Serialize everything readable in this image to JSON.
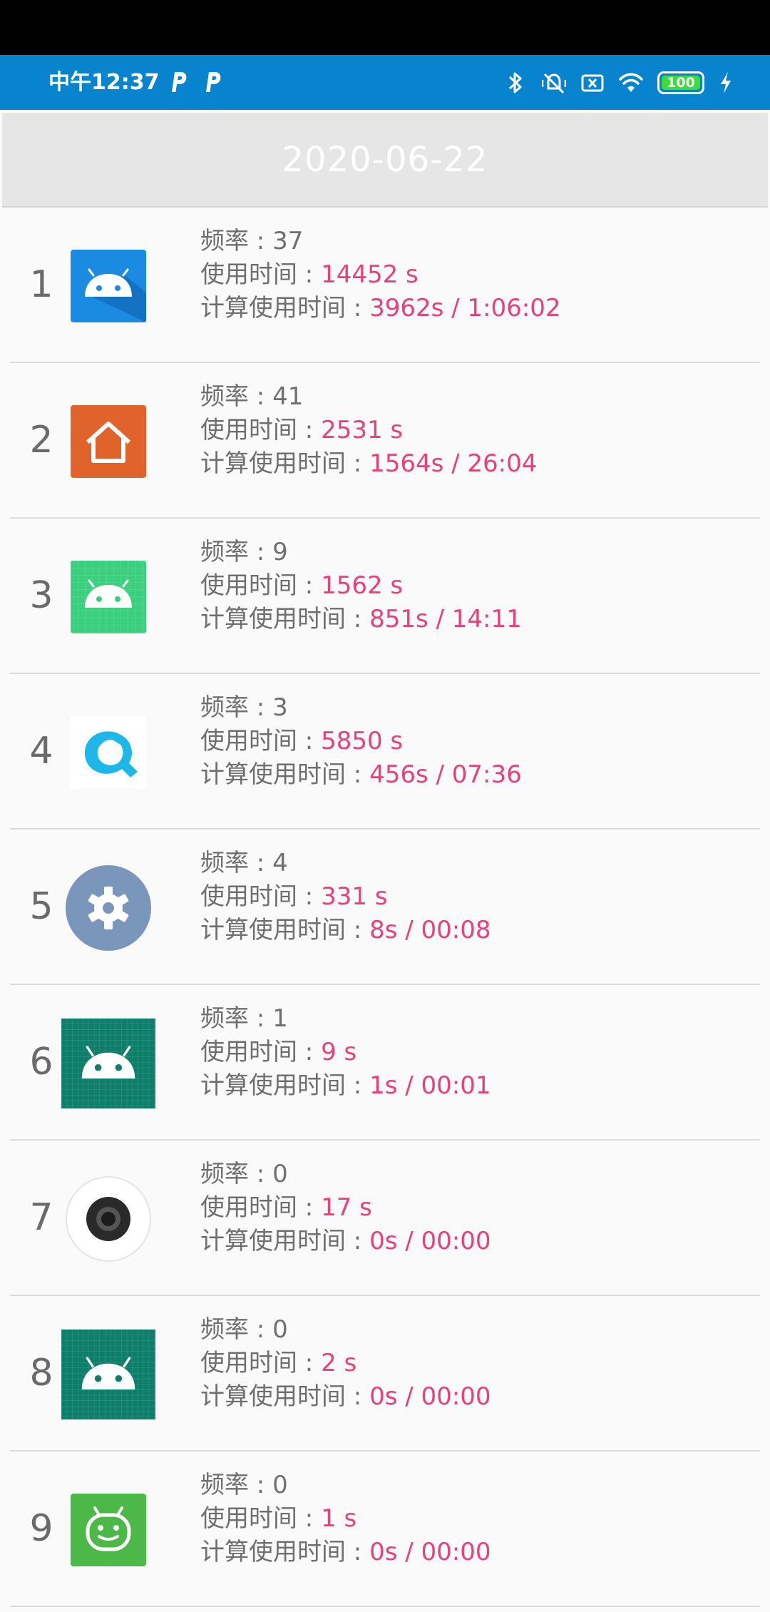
{
  "status_bar": {
    "time": "中午12:37",
    "battery": "100",
    "left_icons": [
      "parking-p-icon",
      "parking-p-icon"
    ],
    "right_icons": [
      "bluetooth-icon",
      "mute-vibrate-icon",
      "sim-card-x-icon",
      "wifi-icon",
      "battery-icon",
      "charging-bolt-icon"
    ]
  },
  "header": {
    "title": "2020-06-22"
  },
  "labels": {
    "frequency": "频率 : ",
    "usage_time": "使用时间 : ",
    "computed_time": "计算使用时间 : "
  },
  "colors": {
    "status_bar": "#0884cf",
    "value_text": "#e8417a",
    "label_text": "#6f6f6f"
  },
  "apps": [
    {
      "rank": "1",
      "icon": "android-blue-app-icon",
      "frequency": "37",
      "usage": "14452 s",
      "computed": "3962s / 1:06:02"
    },
    {
      "rank": "2",
      "icon": "home-launcher-icon",
      "frequency": "41",
      "usage": "2531 s",
      "computed": "1564s / 26:04"
    },
    {
      "rank": "3",
      "icon": "android-green-app-icon",
      "frequency": "9",
      "usage": "1562 s",
      "computed": "851s / 14:11"
    },
    {
      "rank": "4",
      "icon": "q-app-icon",
      "frequency": "3",
      "usage": "5850 s",
      "computed": "456s / 07:36"
    },
    {
      "rank": "5",
      "icon": "settings-gear-icon",
      "frequency": "4",
      "usage": "331 s",
      "computed": "8s / 00:08"
    },
    {
      "rank": "6",
      "icon": "android-teal-app-icon",
      "frequency": "1",
      "usage": "9 s",
      "computed": "1s / 00:01"
    },
    {
      "rank": "7",
      "icon": "camera-icon",
      "frequency": "0",
      "usage": "17 s",
      "computed": "0s / 00:00"
    },
    {
      "rank": "8",
      "icon": "android-teal-app-icon",
      "frequency": "0",
      "usage": "2 s",
      "computed": "0s / 00:00"
    },
    {
      "rank": "9",
      "icon": "robot-green-app-icon",
      "frequency": "0",
      "usage": "1 s",
      "computed": "0s / 00:00"
    }
  ]
}
